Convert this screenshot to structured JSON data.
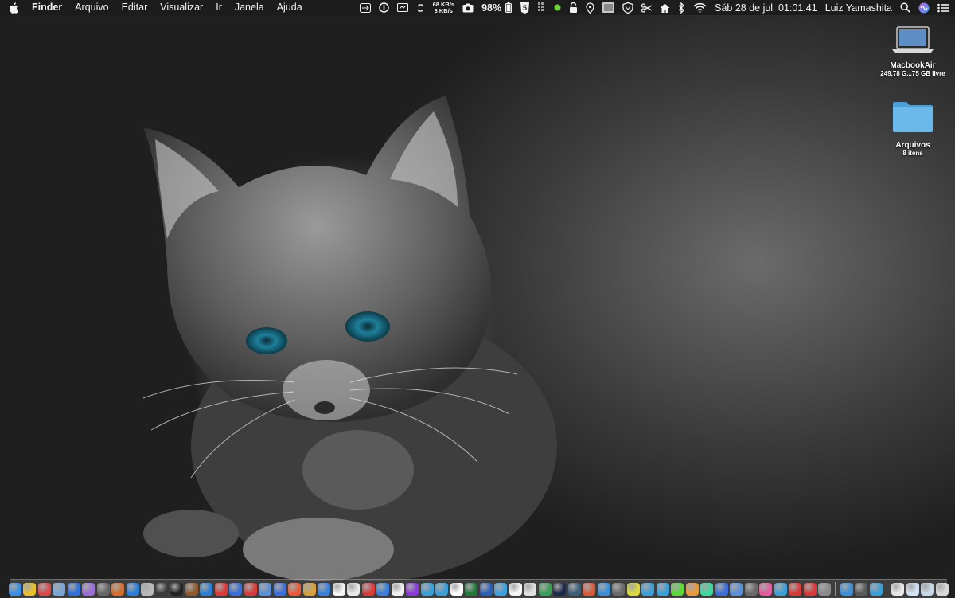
{
  "menubar": {
    "app_name": "Finder",
    "menus": [
      "Arquivo",
      "Editar",
      "Visualizar",
      "Ir",
      "Janela",
      "Ajuda"
    ],
    "net_up": "68 KB/s",
    "net_down": "3 KB/s",
    "battery_percent": "98%",
    "html5_label": "5",
    "datetime": "Sáb 28 de jul  01:01:41",
    "user_name": "Luiz Yamashita"
  },
  "desktop": {
    "items": [
      {
        "name": "MacbookAir",
        "sub": "249,78 G...75 GB livre",
        "icon": "laptop-icon"
      },
      {
        "name": "Arquivos",
        "sub": "8 itens",
        "icon": "folder-icon"
      }
    ]
  },
  "dock": {
    "apps_group1": [
      "#3a8ee6",
      "#e8c02a",
      "#d94b4b",
      "#7aa5d8",
      "#2f6fd9",
      "#9a6ed6",
      "#666666",
      "#d66b2b",
      "#2b7fd6",
      "#b8b8b8",
      "#3a3a3a",
      "#222222",
      "#8c5a2e",
      "#2b7fd6",
      "#d93a3a",
      "#3a6fd9",
      "#d93a3a",
      "#5a8fd6",
      "#3a6fd9",
      "#e85a3a",
      "#d9a03a",
      "#3a7fd9",
      "#f5f5f5",
      "#e8e8e8",
      "#d93a3a",
      "#3a7fd9",
      "#f0f0f0",
      "#8a3ad9",
      "#3a9fd9",
      "#3a9fd9",
      "#ffffff",
      "#1f7a3a",
      "#2b5fb8",
      "#3aa0e0",
      "#f5f5f5",
      "#e0e0e0",
      "#3a9f5a",
      "#1a2a4a",
      "#3a5f7a",
      "#d95a3a",
      "#3a8fd9",
      "#6a6a6a",
      "#d9d93a",
      "#3a9fd9",
      "#3aa0d9",
      "#5ad93a",
      "#e89a3a",
      "#3ad9a0",
      "#3a6fd9",
      "#5a8fd9",
      "#6a6a6a",
      "#e85aa0",
      "#3a9fd9",
      "#d93a3a",
      "#d93a3a",
      "#8a8a8a"
    ],
    "apps_group2": [
      "#3a8fd9",
      "#5a5a5a",
      "#3a9fd9"
    ],
    "apps_group3": [
      "#e8e8e8",
      "#d0e4f5",
      "#c8d8e8",
      "#d8d8d8"
    ]
  }
}
